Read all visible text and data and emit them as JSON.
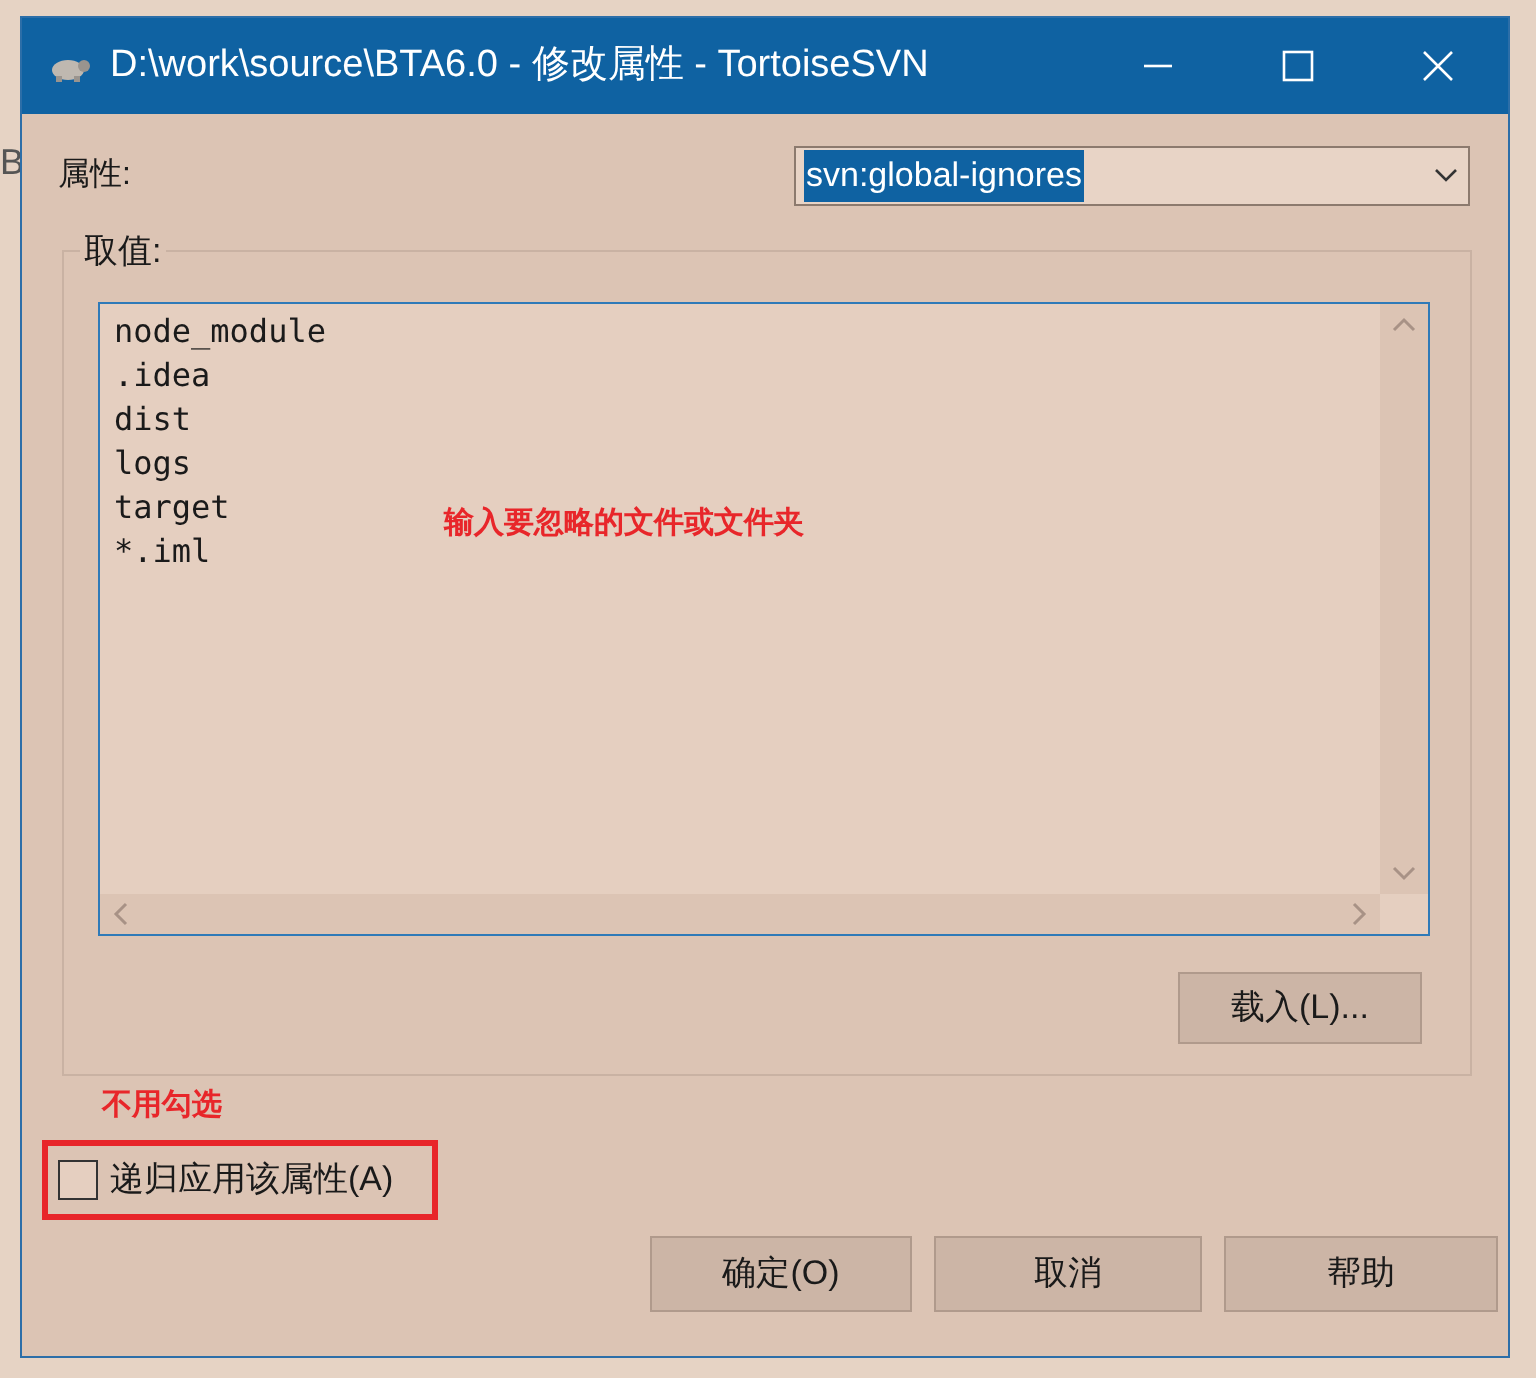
{
  "background_window": {
    "fragments": [
      "B"
    ]
  },
  "window": {
    "title": "D:\\work\\source\\BTA6.0 - 修改属性 - TortoiseSVN"
  },
  "property": {
    "label": "属性:",
    "value": "svn:global-ignores",
    "selected": true
  },
  "value_group": {
    "label": "取值:",
    "lines": [
      "node_module",
      ".idea",
      "dist",
      "logs",
      "target",
      "*.iml"
    ],
    "annotation": "输入要忽略的文件或文件夹",
    "load_button": "载入(L)..."
  },
  "recursive": {
    "annotation": "不用勾选",
    "label": "递归应用该属性(A)",
    "checked": false
  },
  "buttons": [
    "确定(O)",
    "取消",
    "帮助"
  ]
}
